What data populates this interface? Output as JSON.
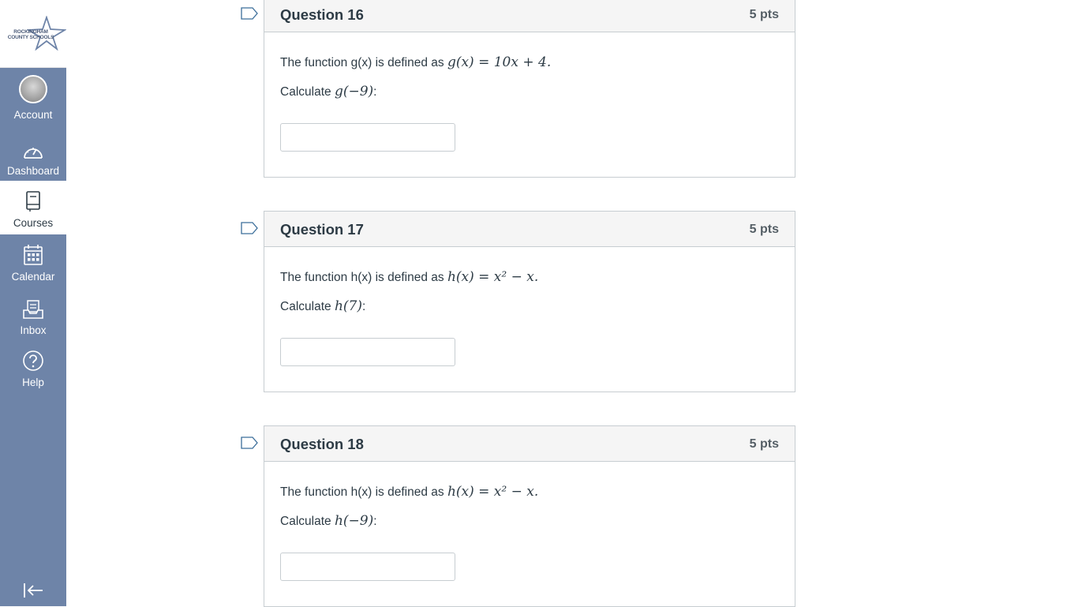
{
  "logo": {
    "line1": "ROCKINGHAM",
    "line2": "COUNTY SCHOOLS"
  },
  "nav": {
    "items": [
      {
        "label": "Account",
        "icon": "avatar"
      },
      {
        "label": "Dashboard",
        "icon": "dashboard-gauge-icon"
      },
      {
        "label": "Courses",
        "icon": "courses-book-icon"
      },
      {
        "label": "Calendar",
        "icon": "calendar-icon"
      },
      {
        "label": "Inbox",
        "icon": "inbox-icon"
      },
      {
        "label": "Help",
        "icon": "help-circle-icon"
      }
    ],
    "collapse_icon": "collapse-nav-icon"
  },
  "colors": {
    "nav_bg": "#6e84a8",
    "header_bg": "#f5f5f5",
    "flag": "#2b7abc"
  },
  "questions": [
    {
      "title": "Question 16",
      "points": "5 pts",
      "text_prefix": "The function g(x) is defined as",
      "equation": "g(x) = 10x + 4.",
      "calc_prefix": "Calculate",
      "calc_expr": "g(−9)",
      "calc_suffix": ":",
      "answer": ""
    },
    {
      "title": "Question 17",
      "points": "5 pts",
      "text_prefix": "The function h(x) is defined as",
      "equation": "h(x) = x² − x.",
      "calc_prefix": "Calculate",
      "calc_expr": "h(7)",
      "calc_suffix": ":",
      "answer": ""
    },
    {
      "title": "Question 18",
      "points": "5 pts",
      "text_prefix": "The function h(x) is defined as",
      "equation": "h(x) = x² − x.",
      "calc_prefix": "Calculate",
      "calc_expr": "h(−9)",
      "calc_suffix": ":",
      "answer": ""
    }
  ]
}
